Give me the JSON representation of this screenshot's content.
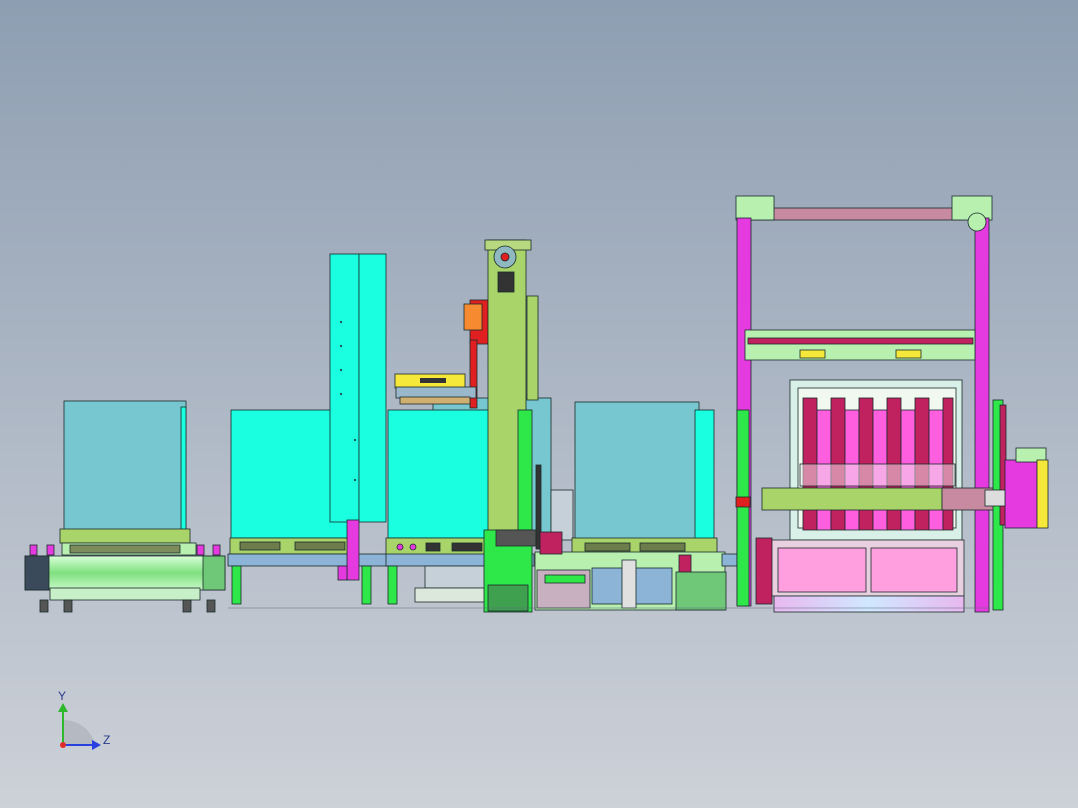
{
  "viewport": {
    "background_top": "#8E9EB2",
    "background_bottom": "#CDD1D8"
  },
  "axis_triad": {
    "y_label": "Y",
    "z_label": "Z",
    "y_color": "#2DB82D",
    "z_color": "#2A3FE0",
    "x_color": "#E02A2A"
  },
  "palette": {
    "cyan_panel": "#19FFE0",
    "teal_panel": "#76C7CF",
    "bright_green": "#2EE84A",
    "olive_green": "#A9D46A",
    "light_green": "#B8F0B0",
    "magenta": "#E43AE0",
    "hot_pink": "#FF6FCF",
    "crimson": "#C0215F",
    "dusty_pink": "#C88AA0",
    "steel_blue": "#8BB4D6",
    "yellow": "#F5E83A",
    "red": "#E02020",
    "outline": "#1A2A2A"
  }
}
